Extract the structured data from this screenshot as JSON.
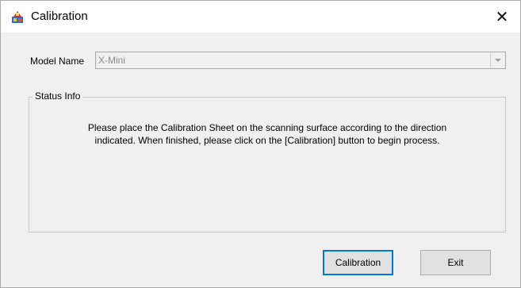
{
  "window": {
    "title": "Calibration",
    "icon": "calibration-app-icon",
    "close_glyph": "✕"
  },
  "form": {
    "model_label": "Model Name",
    "model_value": "X-Mini"
  },
  "status": {
    "legend": "Status Info",
    "line1": "Please place the Calibration Sheet on the scanning surface according to the direction",
    "line2": "indicated. When finished, please click on the [Calibration] button to begin process."
  },
  "buttons": {
    "calibration": "Calibration",
    "exit": "Exit"
  },
  "colors": {
    "dialog_bg": "#f0f0f0",
    "titlebar_bg": "#ffffff",
    "focus_border": "#0078d7",
    "disabled_text": "#8a8a8a"
  }
}
